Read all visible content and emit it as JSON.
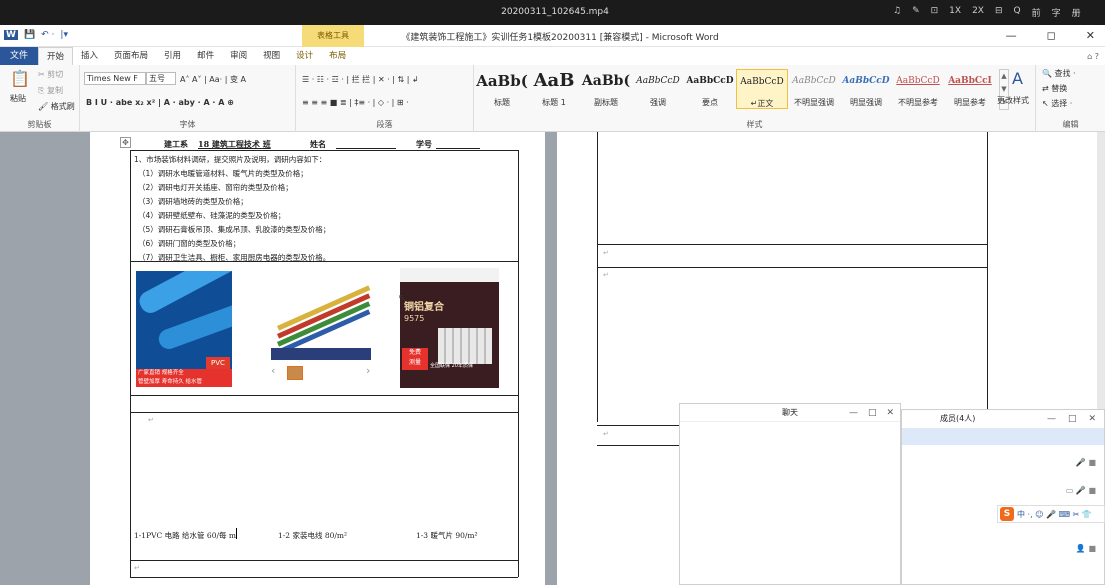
{
  "player": {
    "title": "20200311_102645.mp4",
    "controls": [
      "♫",
      "✎",
      "⊡",
      "1X",
      "2X",
      "⊟",
      "Q",
      "前",
      "字",
      "册"
    ]
  },
  "quick_access": {
    "word_icon": "W",
    "save": "💾",
    "undo": "↶ ·",
    "redo": "↷",
    "more": "|▾"
  },
  "context_tab": {
    "label": "表格工具"
  },
  "window": {
    "title": "《建筑装饰工程施工》实训任务1模板20200311 [兼容模式] - Microsoft Word",
    "min": "—",
    "max": "◻",
    "close": "✕",
    "help": "⌂ ?"
  },
  "tabs": {
    "file": "文件",
    "items": [
      "开始",
      "插入",
      "页面布局",
      "引用",
      "邮件",
      "审阅",
      "视图",
      "设计",
      "布局"
    ]
  },
  "ribbon": {
    "clipboard": {
      "paste": "粘贴",
      "cut": "剪切",
      "copy": "复制",
      "format_painter": "格式刷",
      "label": "剪贴板"
    },
    "font": {
      "name": "Times New F",
      "size": "五号",
      "label": "字体",
      "row1": "A˄ A˅ | Aa· | 变 A",
      "row2": "B  I  U · abe  x₂  x² | A · aby · A · A ⊕"
    },
    "paragraph": {
      "label": "段落",
      "row1": "☰ · ☷ · ☲ · | 拦 拦 | ✕ · | ⇅ | ↲",
      "row2": "≡ ≡ ≡ ■ ≣ | ‡≡ · | ◇ · | ⊞ ·"
    },
    "styles": {
      "label": "样式",
      "items": [
        {
          "sample": "AaBb(",
          "name": "标题"
        },
        {
          "sample": "AaB",
          "name": "标题 1"
        },
        {
          "sample": "AaBb(",
          "name": "副标题"
        },
        {
          "sample": "AaBbCcD",
          "name": "强调"
        },
        {
          "sample": "AaBbCcD",
          "name": "要点"
        },
        {
          "sample": "AaBbCcD",
          "name": "↵正文"
        },
        {
          "sample": "AaBbCcD",
          "name": "不明显强调"
        },
        {
          "sample": "AaBbCcD",
          "name": "明显强调"
        },
        {
          "sample": "AaBbCcD",
          "name": "不明显参考"
        },
        {
          "sample": "AaBbCcI",
          "name": "明显参考"
        }
      ],
      "change_styles": "更改样式"
    },
    "editing": {
      "label": "编辑",
      "find": "查找 ·",
      "replace": "替换",
      "select": "选择 ·"
    }
  },
  "document": {
    "header": {
      "dept": "建工系",
      "class": "18 建筑工程技术  班",
      "name": "姓名",
      "id": "学号"
    },
    "task_title": "1、市场装饰材料调研，提交照片及说明，调研内容如下：",
    "tasks": [
      "（1）调研水电暖管道材料、暖气片的类型及价格；",
      "（2）调研电灯开关插座、窗帘的类型及价格；",
      "（3）调研墙地砖的类型及价格；",
      "（4）调研壁纸壁布、硅藻泥的类型及价格；",
      "（5）调研石膏板吊顶、集成吊顶、乳胶漆的类型及价格；",
      "（6）调研门窗的类型及价格；",
      "（7）调研卫生洁具、橱柜、家用厨房电器的类型及价格。"
    ],
    "captions": [
      "1-1PVC 电路 给水管 60/每 m",
      "1-2 家装电线 80/m²",
      "1-3 暖气片 90/m²"
    ],
    "images": {
      "pvc_badge": "PVC",
      "pvc_text1": "广家直销 规格齐全",
      "pvc_text2": "管壁加厚 寿命持久",
      "pvc_text3": "给水管",
      "radiator_title": "铜铝复合",
      "radiator_model": "9575",
      "radiator_tag1": "免费",
      "radiator_tag2": "测量",
      "radiator_tag3": "全国联保",
      "radiator_tag4": "20年质保"
    },
    "para_mark": "↵"
  },
  "chat": {
    "title": "聊天",
    "min": "—",
    "max": "□",
    "close": "✕"
  },
  "members": {
    "title": "成员(4人)",
    "min": "—",
    "max": "□",
    "close": "✕"
  },
  "ime": {
    "logo": "S",
    "text": "中 ·, ☺ 🎤 ⌨ ✂ 👕"
  }
}
